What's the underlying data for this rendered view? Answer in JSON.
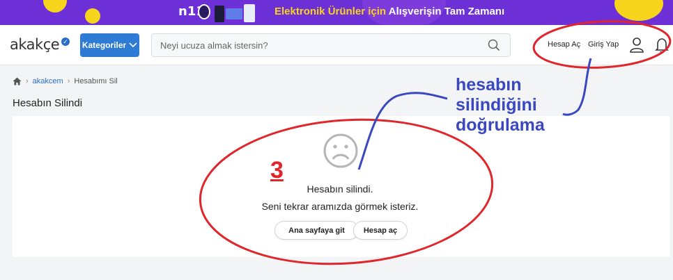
{
  "banner": {
    "brand": "n11",
    "text_highlight": "Elektronik Ürünler için",
    "text_rest": "Alışverişin Tam Zamanı",
    "colors": {
      "background": "#6d2fd6",
      "accent": "#f7d51d"
    }
  },
  "header": {
    "logo": "akakçe",
    "categories_label": "Kategoriler",
    "search_placeholder": "Neyi ucuza almak istersin?",
    "signup_label": "Hesap Aç",
    "login_label": "Giriş Yap",
    "icons": [
      "search-icon",
      "user-icon",
      "bell-icon",
      "chevron-down-icon",
      "check-badge-icon"
    ]
  },
  "breadcrumb": {
    "home_icon": "home-icon",
    "items": [
      "akakcem",
      "Hesabımı Sil"
    ]
  },
  "page": {
    "title": "Hesabın Silindi"
  },
  "main": {
    "icon": "sad-face-icon",
    "message_line1": "Hesabın silindi.",
    "message_line2": "Seni tekrar aramızda görmek isteriz.",
    "home_button": "Ana sayfaya git",
    "account_button": "Hesap aç"
  },
  "annotations": {
    "step_number": "3",
    "note": [
      "hesabın",
      "silindiğini",
      "doğrulama"
    ],
    "colors": {
      "ellipse": "#e0262b",
      "note": "#3a48c0"
    }
  }
}
